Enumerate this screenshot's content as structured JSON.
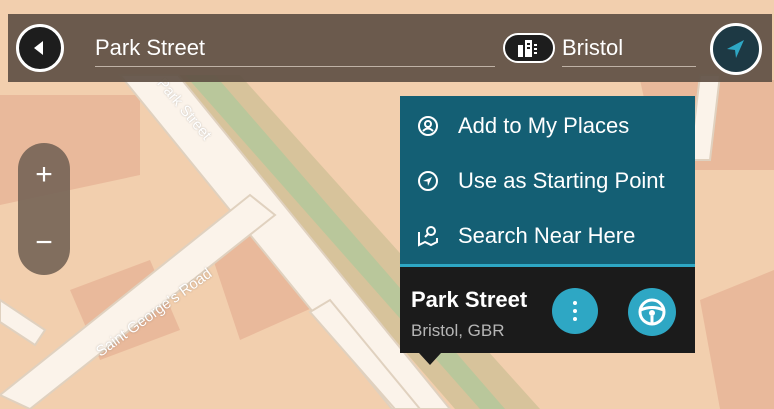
{
  "map": {
    "streets": {
      "park_street_label": "Park Street",
      "saint_georges_road_label": "Saint George's Road"
    },
    "colors": {
      "land": "#f2cfae",
      "block": "#e9b99b",
      "road": "#fbf3ea",
      "road_edge": "#e0d1bf",
      "river": "#b9c79b",
      "grass": "#d7c39b"
    }
  },
  "search": {
    "query": "Park Street",
    "city": "Bristol"
  },
  "icons": {
    "back": "back-arrow-icon",
    "area": "city-buildings-icon",
    "navigate": "navigation-arrow-icon",
    "zoom_in": "plus-icon",
    "zoom_out": "minus-icon",
    "add_place": "location-pin-icon",
    "start_point": "compass-arrow-icon",
    "search_near": "search-near-icon",
    "more": "more-vertical-icon",
    "drive": "steering-wheel-icon"
  },
  "zoom": {
    "in_label": "+",
    "out_label": "−"
  },
  "popup_menu": {
    "items": [
      {
        "id": "add-to-my-places",
        "label": "Add to My Places"
      },
      {
        "id": "use-as-starting-point",
        "label": "Use as Starting Point"
      },
      {
        "id": "search-near-here",
        "label": "Search Near Here"
      }
    ]
  },
  "location_card": {
    "name": "Park Street",
    "subtitle": "Bristol, GBR"
  },
  "colors": {
    "menu_bg": "#145f74",
    "accent": "#2ea7c4",
    "card_bg": "#1b1b1b",
    "topbar_bg": "#5f5044"
  }
}
